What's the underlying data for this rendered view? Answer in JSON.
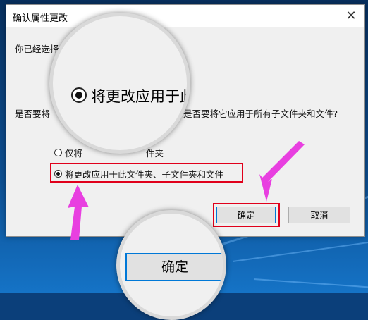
{
  "dialog": {
    "title": "确认属性更改",
    "close_glyph": "✕",
    "intro_text": "你已经选择",
    "question_left": "是否要将",
    "question_right": "是否要将它应用于所有子文件夹和文件?",
    "options": [
      {
        "label_visible": "仅将",
        "label_tail": "件夹",
        "selected": false
      },
      {
        "label": "将更改应用于此文件夹、子文件夹和文件",
        "selected": true
      }
    ],
    "ok_label": "确定",
    "cancel_label": "取消"
  },
  "zoom_top": {
    "label": "将更改应用于此文"
  },
  "zoom_bottom": {
    "label": "确定"
  },
  "colors": {
    "highlight": "#e0001b",
    "arrow": "#e83fe0",
    "accent": "#0078d7"
  }
}
